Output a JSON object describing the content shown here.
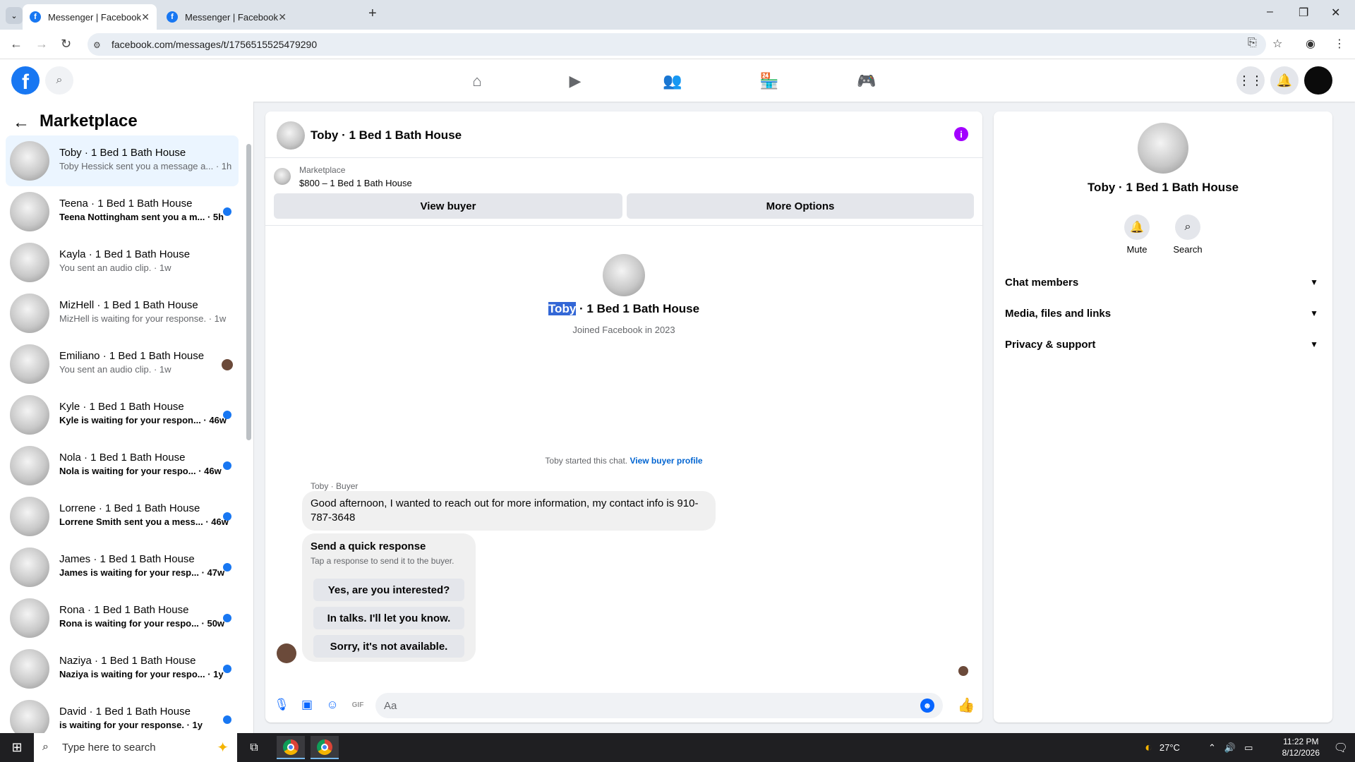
{
  "browser": {
    "tabs": [
      {
        "title": "Messenger | Facebook",
        "favicon": "facebook-icon"
      },
      {
        "title": "Messenger | Facebook",
        "favicon": "facebook-icon"
      }
    ],
    "url": "facebook.com/messages/t/1756515525479290",
    "window_controls": {
      "minimize": "–",
      "restore": "❐",
      "close": "✕"
    }
  },
  "fb_nav": {
    "logo": "f",
    "icons": [
      "home-icon",
      "video-icon",
      "friends-icon",
      "marketplace-icon",
      "gaming-icon"
    ],
    "right_icons": [
      "menu-grid-icon",
      "notifications-icon",
      "profile-avatar"
    ]
  },
  "sidebar": {
    "title": "Marketplace",
    "conversations": [
      {
        "name": "Toby · 1 Bed 1 Bath House",
        "preview": "Toby Hessick sent you a message a... · 1h",
        "selected": true,
        "unread": false
      },
      {
        "name": "Teena · 1 Bed 1 Bath House",
        "preview": "Teena Nottingham sent you a m... · 5h",
        "unread": true
      },
      {
        "name": "Kayla · 1 Bed 1 Bath House",
        "preview": "You sent an audio clip. · 1w",
        "unread": false
      },
      {
        "name": "MizHell · 1 Bed 1 Bath House",
        "preview": "MizHell is waiting for your response. · 1w",
        "unread": false
      },
      {
        "name": "Emiliano · 1 Bed 1 Bath House",
        "preview": "You sent an audio clip. · 1w",
        "unread": false,
        "seen_avatar": true
      },
      {
        "name": "Kyle · 1 Bed 1 Bath House",
        "preview": "Kyle is waiting for your respon... · 46w",
        "unread": true
      },
      {
        "name": "Nola · 1 Bed 1 Bath House",
        "preview": "Nola is waiting for your respo... · 46w",
        "unread": true
      },
      {
        "name": "Lorrene · 1 Bed 1 Bath House",
        "preview": "Lorrene Smith sent you a mess... · 46w",
        "unread": true
      },
      {
        "name": "James · 1 Bed 1 Bath House",
        "preview": "James is waiting for your resp... · 47w",
        "unread": true
      },
      {
        "name": "Rona · 1 Bed 1 Bath House",
        "preview": "Rona is waiting for your respo... · 50w",
        "unread": true
      },
      {
        "name": "Naziya · 1 Bed 1 Bath House",
        "preview": "Naziya is waiting for your respo... · 1y",
        "unread": true
      },
      {
        "name": "David · 1 Bed 1 Bath House",
        "preview": "is waiting for your response. · 1y",
        "unread": true
      }
    ]
  },
  "chat": {
    "header_title": "Toby · 1 Bed 1 Bath House",
    "marketplace_label": "Marketplace",
    "listing": "$800 – 1 Bed 1 Bath House",
    "view_buyer": "View buyer",
    "more_options": "More Options",
    "intro_name_highlight": "Toby",
    "intro_name_rest": " · 1 Bed 1 Bath House",
    "intro_sub": "Joined Facebook in 2023",
    "started_text": "Toby started this chat. ",
    "started_link": "View buyer profile",
    "sender_label": "Toby · Buyer",
    "message": "Good afternoon, I wanted to reach out for more information, my contact info is 910-787-3648",
    "quick_title": "Send a quick response",
    "quick_sub": "Tap a response to send it to the buyer.",
    "quick_replies": [
      "Yes, are you interested?",
      "In talks. I'll let you know.",
      "Sorry, it's not available."
    ],
    "composer_placeholder": "Aa"
  },
  "info_panel": {
    "name": "Toby · 1 Bed 1 Bath House",
    "actions": [
      {
        "label": "Mute",
        "icon": "bell-icon"
      },
      {
        "label": "Search",
        "icon": "search-icon"
      }
    ],
    "sections": [
      "Chat members",
      "Media, files and links",
      "Privacy & support"
    ]
  },
  "taskbar": {
    "search_placeholder": "Type here to search",
    "temperature": "27°C",
    "time": "11:22 PM",
    "date": "8/12/2026"
  }
}
